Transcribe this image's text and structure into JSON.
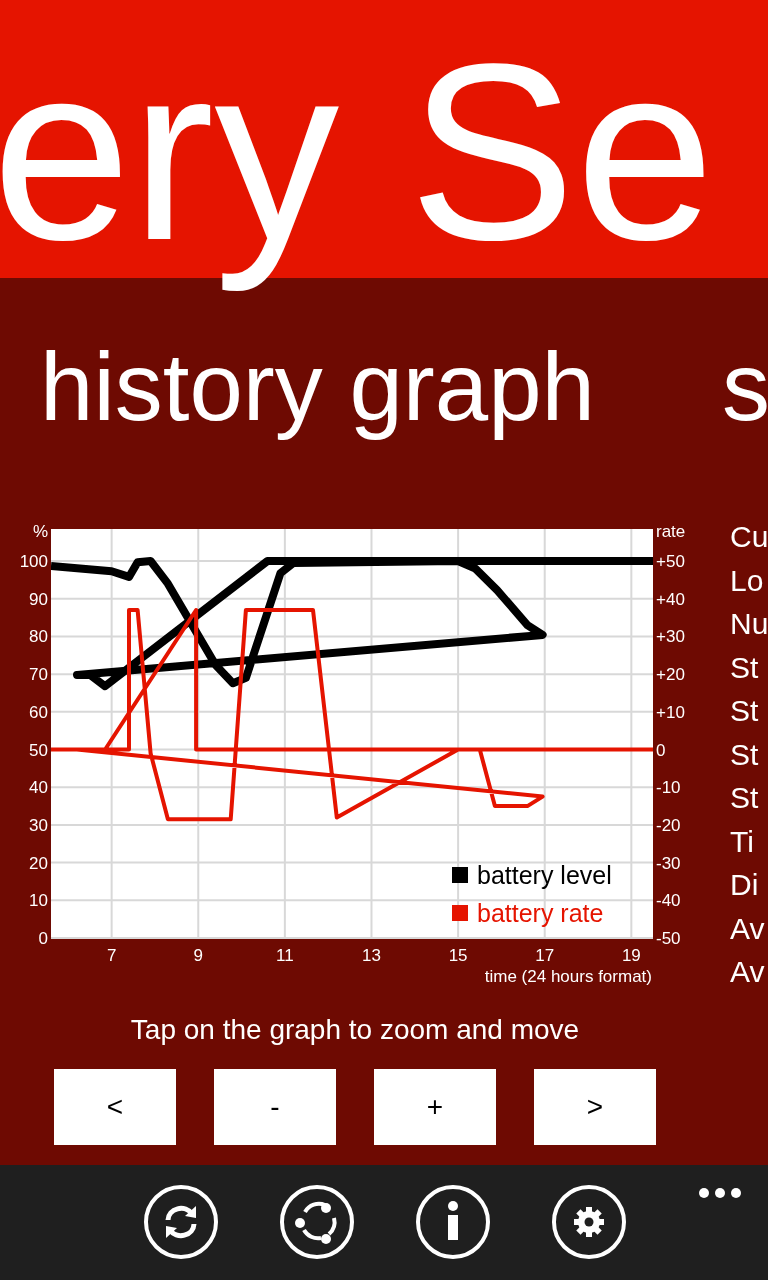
{
  "app_title": "ery Se",
  "section": {
    "title": "history graph",
    "next_title": "s"
  },
  "chart_data": {
    "type": "line",
    "grid": true,
    "legend": "lower right",
    "ylabel": "%",
    "xlabel": "time (24 hours format)",
    "xlim": [
      5.6,
      19.5
    ],
    "ylim": [
      0,
      108.5
    ],
    "xticks": [
      7,
      9,
      11,
      13,
      15,
      17,
      19
    ],
    "yticks": [
      0,
      10,
      20,
      30,
      40,
      50,
      60,
      70,
      80,
      90,
      100
    ],
    "y2label": "rate",
    "y2lim": [
      -50,
      58.5
    ],
    "y2ticks": [
      {
        "value": 50,
        "label": "+50"
      },
      {
        "value": 40,
        "label": "+40"
      },
      {
        "value": 30,
        "label": "+30"
      },
      {
        "value": 20,
        "label": "+20"
      },
      {
        "value": 10,
        "label": "+10"
      },
      {
        "value": 0,
        "label": "0"
      },
      {
        "value": -10,
        "label": "-10"
      },
      {
        "value": -20,
        "label": "-20"
      },
      {
        "value": -30,
        "label": "-30"
      },
      {
        "value": -40,
        "label": "-40"
      },
      {
        "value": -50,
        "label": "-50"
      }
    ],
    "series": [
      {
        "name": "battery level",
        "color": "#000000",
        "x": [
          5.6,
          7.0,
          7.4,
          7.6,
          7.9,
          8.3,
          9.4,
          9.8,
          10.1,
          10.9,
          11.2,
          15.0,
          15.4,
          15.9,
          16.6,
          16.95,
          6.2,
          6.5,
          6.85,
          10.6,
          19.5
        ],
        "values": [
          98.7,
          97.3,
          95.8,
          99.7,
          100,
          94,
          72.4,
          67.6,
          69,
          96.8,
          99.5,
          100,
          98,
          92.3,
          83,
          80.4,
          69.8,
          69.8,
          66.8,
          100,
          100
        ]
      },
      {
        "name": "battery rate",
        "color": "#e51400",
        "axis": "y2",
        "x": [
          5.6,
          7.4,
          7.4,
          7.6,
          7.9,
          8.3,
          9.75,
          10.1,
          11.65,
          12.2,
          15.0,
          15.5,
          15.85,
          16.6,
          16.95,
          6.2,
          6.85,
          8.95,
          8.95,
          19.5
        ],
        "values": [
          0,
          0,
          37,
          37,
          -1,
          -18.5,
          -18.5,
          37,
          37,
          -18,
          0,
          0,
          -15,
          -15,
          -12.5,
          0,
          0,
          37,
          0,
          0
        ]
      }
    ]
  },
  "stats_labels": [
    "Cu",
    "Lo",
    "Nu",
    "St",
    "St",
    "St",
    "St",
    "Ti",
    "Di",
    "Av",
    "Av"
  ],
  "hint": "Tap on the graph to zoom and move",
  "buttons": [
    {
      "label": "<"
    },
    {
      "label": "-"
    },
    {
      "label": "+"
    },
    {
      "label": ">"
    }
  ]
}
